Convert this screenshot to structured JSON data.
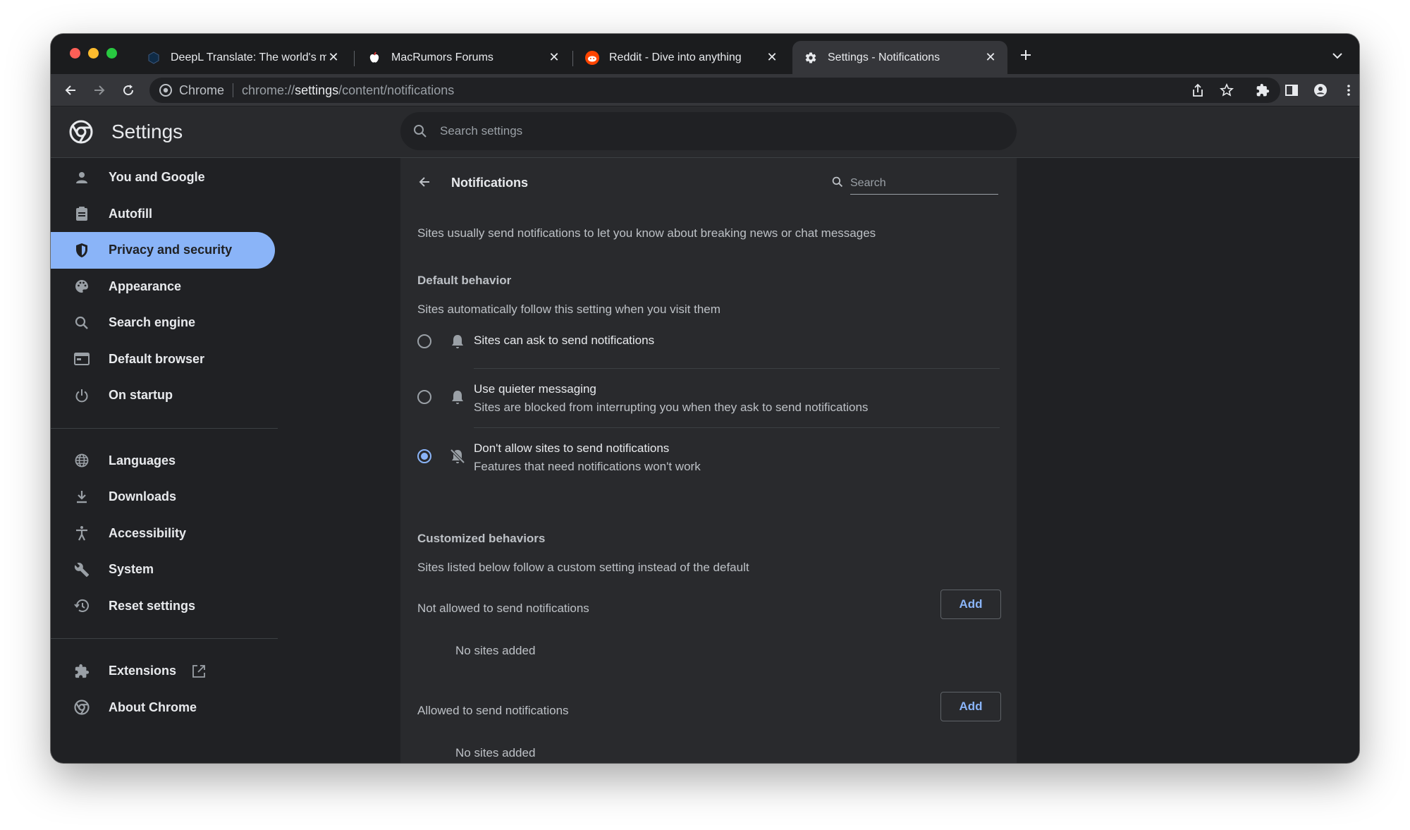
{
  "tabs": [
    {
      "title": "DeepL Translate: The world's m",
      "favicon": "deepl-icon",
      "active": false
    },
    {
      "title": "MacRumors Forums",
      "favicon": "macrumors-icon",
      "active": false
    },
    {
      "title": "Reddit - Dive into anything",
      "favicon": "reddit-icon",
      "active": false
    },
    {
      "title": "Settings - Notifications",
      "favicon": "gear-icon",
      "active": true
    }
  ],
  "omnibox": {
    "site_label": "Chrome",
    "url_prefix": "chrome://",
    "url_host": "settings",
    "url_path": "/content/notifications"
  },
  "header": {
    "title": "Settings",
    "search_placeholder": "Search settings"
  },
  "sidebar": {
    "groups": [
      [
        {
          "label": "You and Google",
          "icon": "person-icon"
        },
        {
          "label": "Autofill",
          "icon": "clipboard-icon"
        },
        {
          "label": "Privacy and security",
          "icon": "shield-icon",
          "selected": true
        },
        {
          "label": "Appearance",
          "icon": "palette-icon"
        },
        {
          "label": "Search engine",
          "icon": "search-icon"
        },
        {
          "label": "Default browser",
          "icon": "browser-icon"
        },
        {
          "label": "On startup",
          "icon": "power-icon"
        }
      ],
      [
        {
          "label": "Languages",
          "icon": "globe-icon"
        },
        {
          "label": "Downloads",
          "icon": "download-icon"
        },
        {
          "label": "Accessibility",
          "icon": "accessibility-icon"
        },
        {
          "label": "System",
          "icon": "wrench-icon"
        },
        {
          "label": "Reset settings",
          "icon": "history-icon"
        }
      ],
      [
        {
          "label": "Extensions",
          "icon": "puzzle-icon",
          "external": true
        },
        {
          "label": "About Chrome",
          "icon": "chrome-logo-icon"
        }
      ]
    ]
  },
  "notifications": {
    "title": "Notifications",
    "search_placeholder": "Search",
    "intro": "Sites usually send notifications to let you know about breaking news or chat messages",
    "default_behavior": {
      "title": "Default behavior",
      "description": "Sites automatically follow this setting when you visit them",
      "options": [
        {
          "label": "Sites can ask to send notifications",
          "sublabel": "",
          "icon": "bell-icon",
          "checked": false
        },
        {
          "label": "Use quieter messaging",
          "sublabel": "Sites are blocked from interrupting you when they ask to send notifications",
          "icon": "bell-icon",
          "checked": false
        },
        {
          "label": "Don't allow sites to send notifications",
          "sublabel": "Features that need notifications won't work",
          "icon": "bell-off-icon",
          "checked": true
        }
      ]
    },
    "customized": {
      "title": "Customized behaviors",
      "description": "Sites listed below follow a custom setting instead of the default",
      "lists": [
        {
          "label": "Not allowed to send notifications",
          "button": "Add",
          "empty": "No sites added"
        },
        {
          "label": "Allowed to send notifications",
          "button": "Add",
          "empty": "No sites added"
        }
      ]
    }
  },
  "colors": {
    "accent": "#8ab4f8",
    "background": "#202124",
    "card": "#292a2d"
  }
}
